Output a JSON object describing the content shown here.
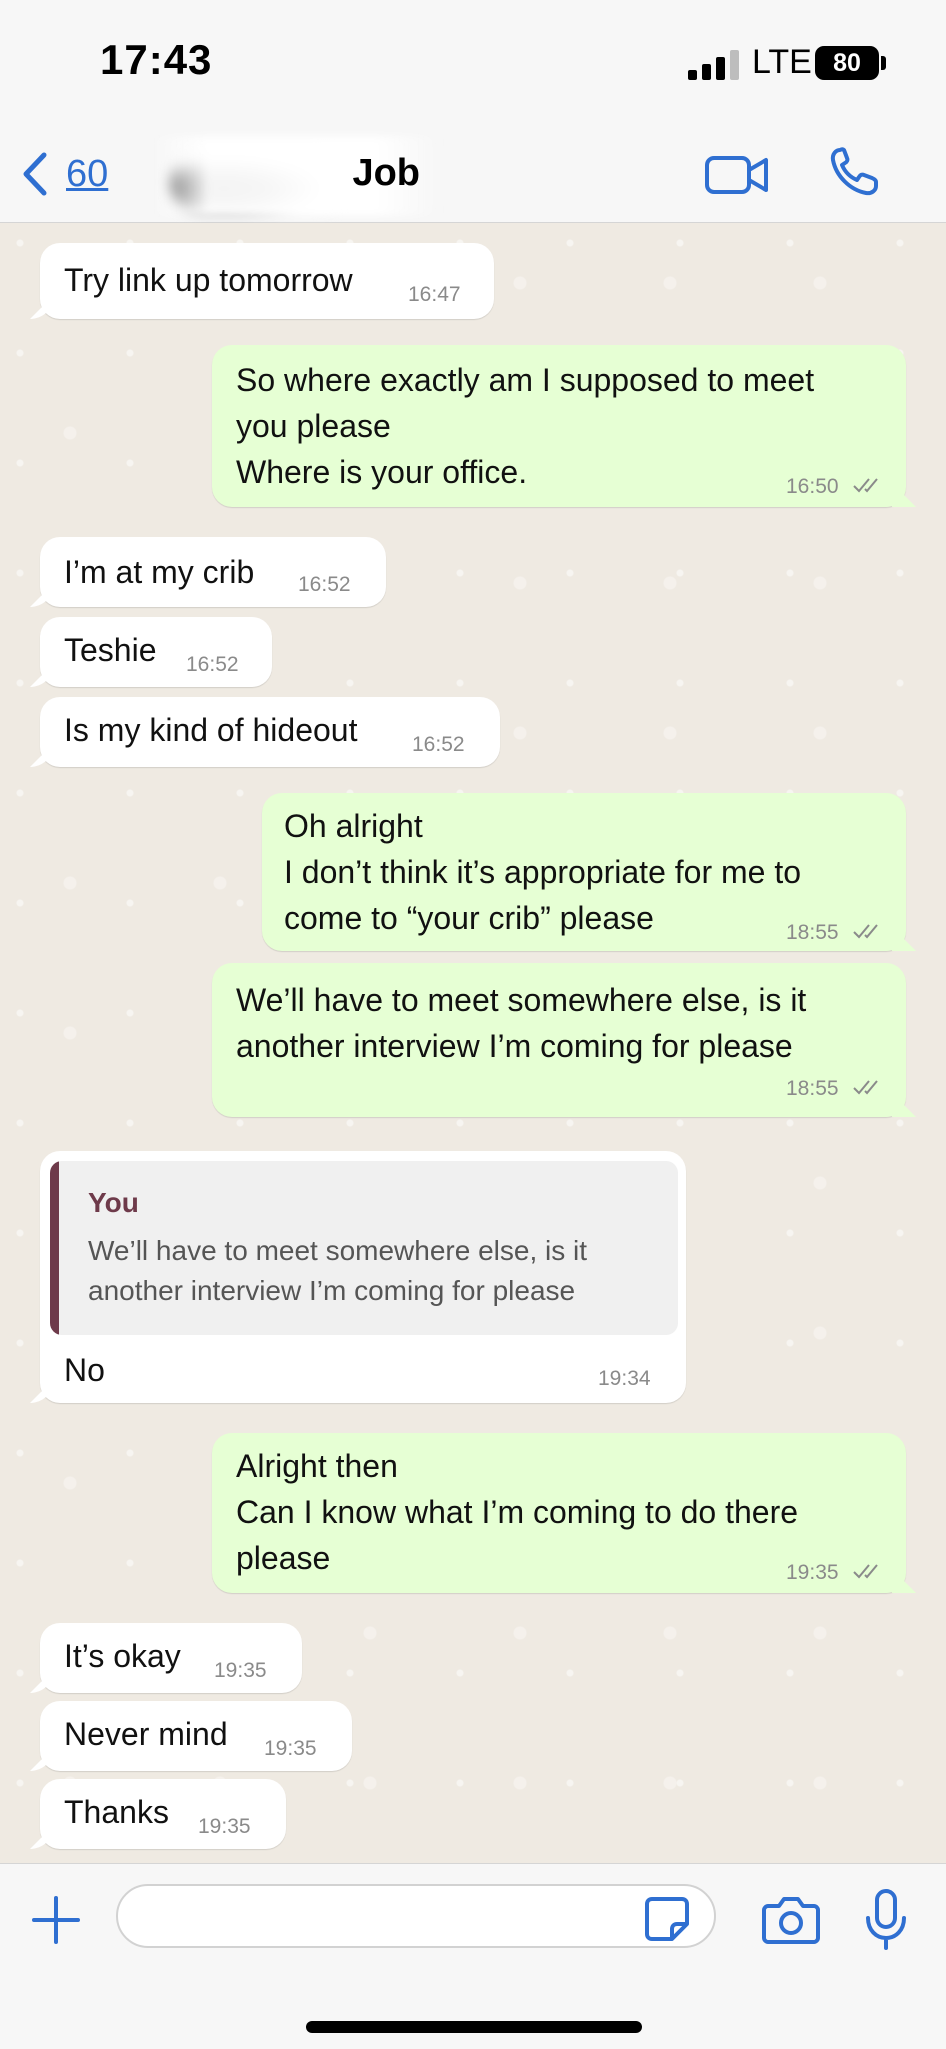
{
  "status_bar": {
    "time": "17:43",
    "network": "LTE",
    "battery": "80"
  },
  "header": {
    "back_count": "60",
    "contact_name": "Job",
    "icons": [
      "chevron-left-icon",
      "video-icon",
      "phone-icon"
    ]
  },
  "messages": [
    {
      "dir": "in",
      "text": "Try link up tomorrow",
      "time": "16:47"
    },
    {
      "dir": "out",
      "text": "So where exactly am I supposed to meet\nyou please\nWhere is your office.",
      "time": "16:50"
    },
    {
      "dir": "in",
      "text": "I’m at my crib",
      "time": "16:52"
    },
    {
      "dir": "in",
      "text": "Teshie",
      "time": "16:52"
    },
    {
      "dir": "in",
      "text": "Is my kind of hideout",
      "time": "16:52"
    },
    {
      "dir": "out",
      "text": "Oh alright\nI don’t think it’s appropriate for me to\ncome to “your crib” please",
      "time": "18:55"
    },
    {
      "dir": "out",
      "text": "We’ll have to meet somewhere else, is it\nanother interview I’m coming for please",
      "time": "18:55"
    },
    {
      "dir": "in",
      "text": "No",
      "time": "19:34",
      "quote": {
        "author": "You",
        "text": "We’ll have to meet somewhere else, is it\nanother interview I’m coming for please"
      }
    },
    {
      "dir": "out",
      "text": "Alright then\nCan I know what I’m coming to do there\nplease",
      "time": "19:35"
    },
    {
      "dir": "in",
      "text": "It’s okay",
      "time": "19:35"
    },
    {
      "dir": "in",
      "text": "Never mind",
      "time": "19:35"
    },
    {
      "dir": "in",
      "text": "Thanks",
      "time": "19:35"
    }
  ],
  "composer": {
    "input_value": "",
    "icons": [
      "plus-icon",
      "sticker-icon",
      "camera-icon",
      "microphone-icon"
    ]
  },
  "colors": {
    "accent": "#2f6fd1",
    "outgoing_bubble": "#e6ffd4",
    "incoming_bubble": "#ffffff",
    "chat_background": "#efeae2",
    "quote_accent": "#6e3a4a"
  }
}
